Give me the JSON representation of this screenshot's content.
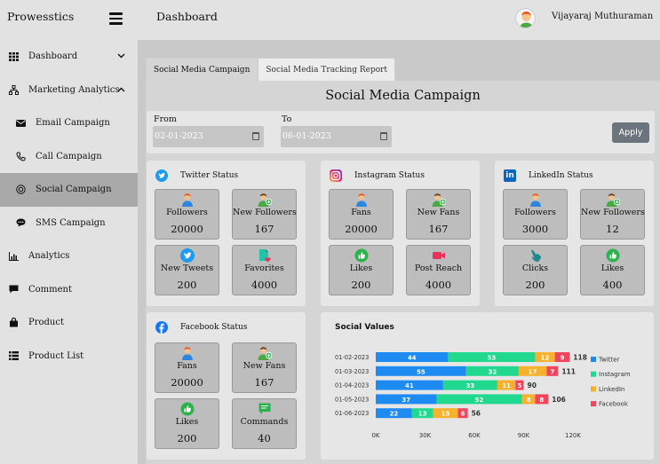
{
  "app": {
    "brand": "Prowesstics",
    "page_title": "Dashboard",
    "user_name": "Vijayaraj Muthuraman"
  },
  "sidebar": {
    "items": [
      {
        "label": "Dashboard",
        "icon": "grid-icon",
        "chevron": "down"
      },
      {
        "label": "Marketing Analytics",
        "icon": "sitemap-icon",
        "chevron": "up"
      },
      {
        "label": "Email Campaign",
        "icon": "envelope-icon"
      },
      {
        "label": "Call Campaign",
        "icon": "phone-icon"
      },
      {
        "label": "Social Campaign",
        "icon": "target-icon",
        "active": true
      },
      {
        "label": "SMS Campaign",
        "icon": "sms-icon"
      },
      {
        "label": "Analytics",
        "icon": "bar-chart-icon"
      },
      {
        "label": "Comment",
        "icon": "comment-icon"
      },
      {
        "label": "Product",
        "icon": "bag-icon"
      },
      {
        "label": "Product List",
        "icon": "list-icon"
      }
    ]
  },
  "tabs": [
    {
      "label": "Social Media Campaign",
      "active": true
    },
    {
      "label": "Social Media Tracking Report",
      "active": false
    }
  ],
  "campaign_title": "Social Media Campaign",
  "filter": {
    "from_label": "From",
    "to_label": "To",
    "from_value": "02-01-2023",
    "to_value": "06-01-2023",
    "apply_label": "Apply"
  },
  "twitter": {
    "title": "Twitter Status",
    "color": "#1d9bf0",
    "metrics": [
      {
        "label": "Followers",
        "value": "20000"
      },
      {
        "label": "New Followers",
        "value": "167"
      },
      {
        "label": "New Tweets",
        "value": "200"
      },
      {
        "label": "Favorites",
        "value": "4000"
      }
    ]
  },
  "instagram": {
    "title": "Instagram Status",
    "metrics": [
      {
        "label": "Fans",
        "value": "20000"
      },
      {
        "label": "New Fans",
        "value": "167"
      },
      {
        "label": "Likes",
        "value": "200"
      },
      {
        "label": "Post Reach",
        "value": "4000"
      }
    ]
  },
  "linkedin": {
    "title": "LinkedIn Status",
    "color": "#0a66c2",
    "metrics": [
      {
        "label": "Followers",
        "value": "3000"
      },
      {
        "label": "New Followers",
        "value": "12"
      },
      {
        "label": "Clicks",
        "value": "200"
      },
      {
        "label": "Likes",
        "value": "400"
      }
    ]
  },
  "facebook": {
    "title": "Facebook Status",
    "color": "#1877f2",
    "metrics": [
      {
        "label": "Fans",
        "value": "20000"
      },
      {
        "label": "New Fans",
        "value": "167"
      },
      {
        "label": "Likes",
        "value": "200"
      },
      {
        "label": "Commands",
        "value": "40"
      }
    ]
  },
  "chart_data": {
    "type": "bar",
    "orientation": "horizontal",
    "stacked": true,
    "title": "Social Values",
    "categories": [
      "01-02-2023",
      "01-03-2023",
      "01-04-2023",
      "01-05-2023",
      "01-06-2023"
    ],
    "series": [
      {
        "name": "Twitter",
        "color": "#1e8bf3",
        "values": [
          44,
          55,
          41,
          37,
          22
        ]
      },
      {
        "name": "Instagram",
        "color": "#20d98f",
        "values": [
          53,
          32,
          33,
          52,
          13
        ]
      },
      {
        "name": "LinkedIn",
        "color": "#f6b12e",
        "values": [
          12,
          17,
          11,
          8,
          15
        ]
      },
      {
        "name": "Facebook",
        "color": "#f0455d",
        "values": [
          9,
          7,
          5,
          8,
          6
        ]
      }
    ],
    "totals": [
      118,
      111,
      90,
      106,
      56
    ],
    "x_tick_labels": [
      "0K",
      "30K",
      "60K",
      "90K",
      "120K"
    ],
    "xlim": [
      0,
      120
    ],
    "legend_position": "right"
  }
}
